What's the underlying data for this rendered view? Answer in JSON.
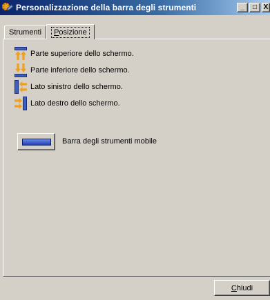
{
  "window": {
    "title": "Personalizzazione della barra degli strumenti",
    "minimize_glyph": "_",
    "maximize_glyph": "□",
    "close_glyph": "X"
  },
  "tabs": [
    {
      "label_first": "",
      "label_key": "",
      "label_rest": "Strumenti"
    },
    {
      "label_first": "",
      "label_key": "P",
      "label_rest": "osizione",
      "active": true
    }
  ],
  "options": [
    {
      "label": "Parte superiore dello schermo.",
      "icon": "toolbar-top-icon"
    },
    {
      "label": "Parte inferiore dello schermo.",
      "icon": "toolbar-bottom-icon"
    },
    {
      "label": "Lato sinistro dello schermo.",
      "icon": "toolbar-left-icon"
    },
    {
      "label": "Lato destro dello schermo.",
      "icon": "toolbar-right-icon"
    }
  ],
  "floating": {
    "label": "Barra degli strumenti mobile",
    "icon": "floating-toolbar-icon"
  },
  "footer": {
    "close_key": "C",
    "close_rest": "hiudi"
  },
  "colors": {
    "titlebar_start": "#0a246a",
    "titlebar_end": "#a6caf0",
    "face": "#d4d0c8",
    "icon_blue": "#4060c0",
    "icon_orange": "#f0a020"
  }
}
